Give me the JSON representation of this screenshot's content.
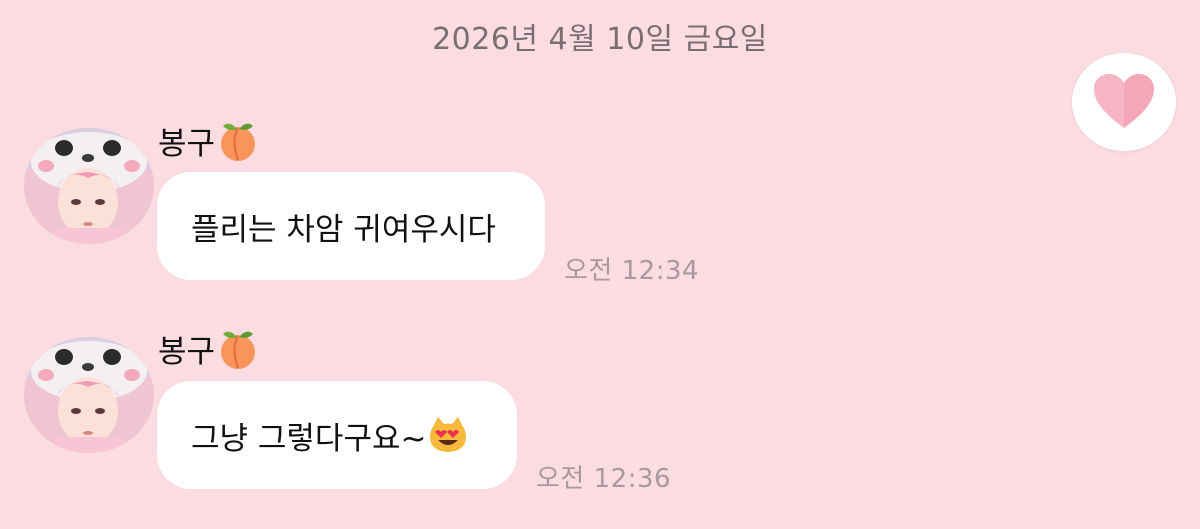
{
  "header": {
    "date": "2026년 4월 10일 금요일"
  },
  "reaction": {
    "icon": "heart-icon",
    "color": "#f2a5b6"
  },
  "messages": [
    {
      "sender": "봉구",
      "sender_emoji": "peach-icon",
      "text": "플리는 차암 귀여우시다",
      "time": "오전 12:34"
    },
    {
      "sender": "봉구",
      "sender_emoji": "peach-icon",
      "text": "그냥 그렇다구요~",
      "text_emoji": "smiling-cat-heart-eyes-icon",
      "time": "오전 12:36"
    }
  ],
  "colors": {
    "background": "#fadce2",
    "bubble": "#ffffff",
    "time": "#a9999e"
  }
}
